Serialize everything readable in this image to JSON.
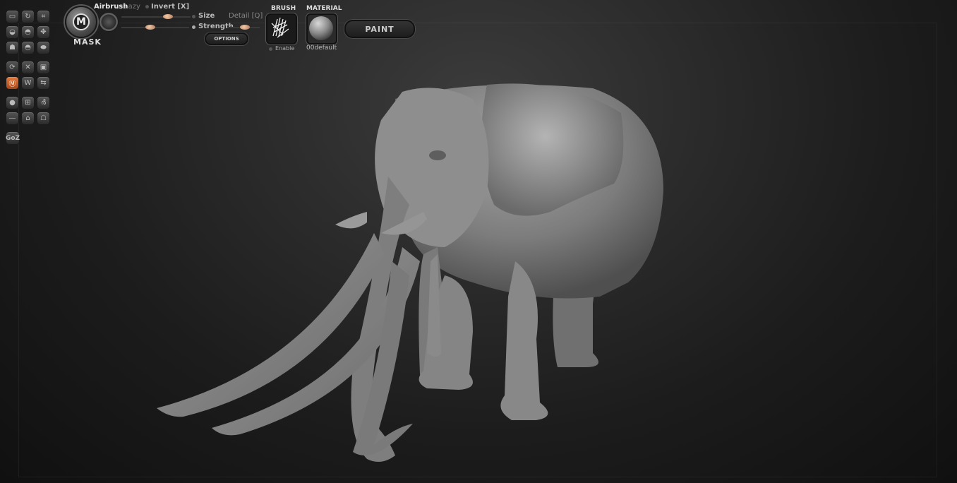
{
  "header": {
    "mask_label": "MASK",
    "mask_glyph": "M",
    "stroke_label": "Airbrush",
    "lazy_label": "Lazy",
    "invert_label": "Invert [X]",
    "size_label": "Size",
    "detail_label": "Detail [Q]",
    "strength_label": "Strength",
    "options_label": "OPTIONS",
    "brush_label": "BRUSH",
    "enable_label": "Enable",
    "material_label": "MATERIAL",
    "material_name": "00default",
    "paint_label": "PAINT"
  },
  "toolbar": {
    "goz_label": "GoZ"
  },
  "colors": {
    "accent": "#d86a2c",
    "slider_knob": "#d8a888",
    "model": "#8a8a8a"
  },
  "viewport": {
    "model_name": "elephant-sculpt"
  }
}
